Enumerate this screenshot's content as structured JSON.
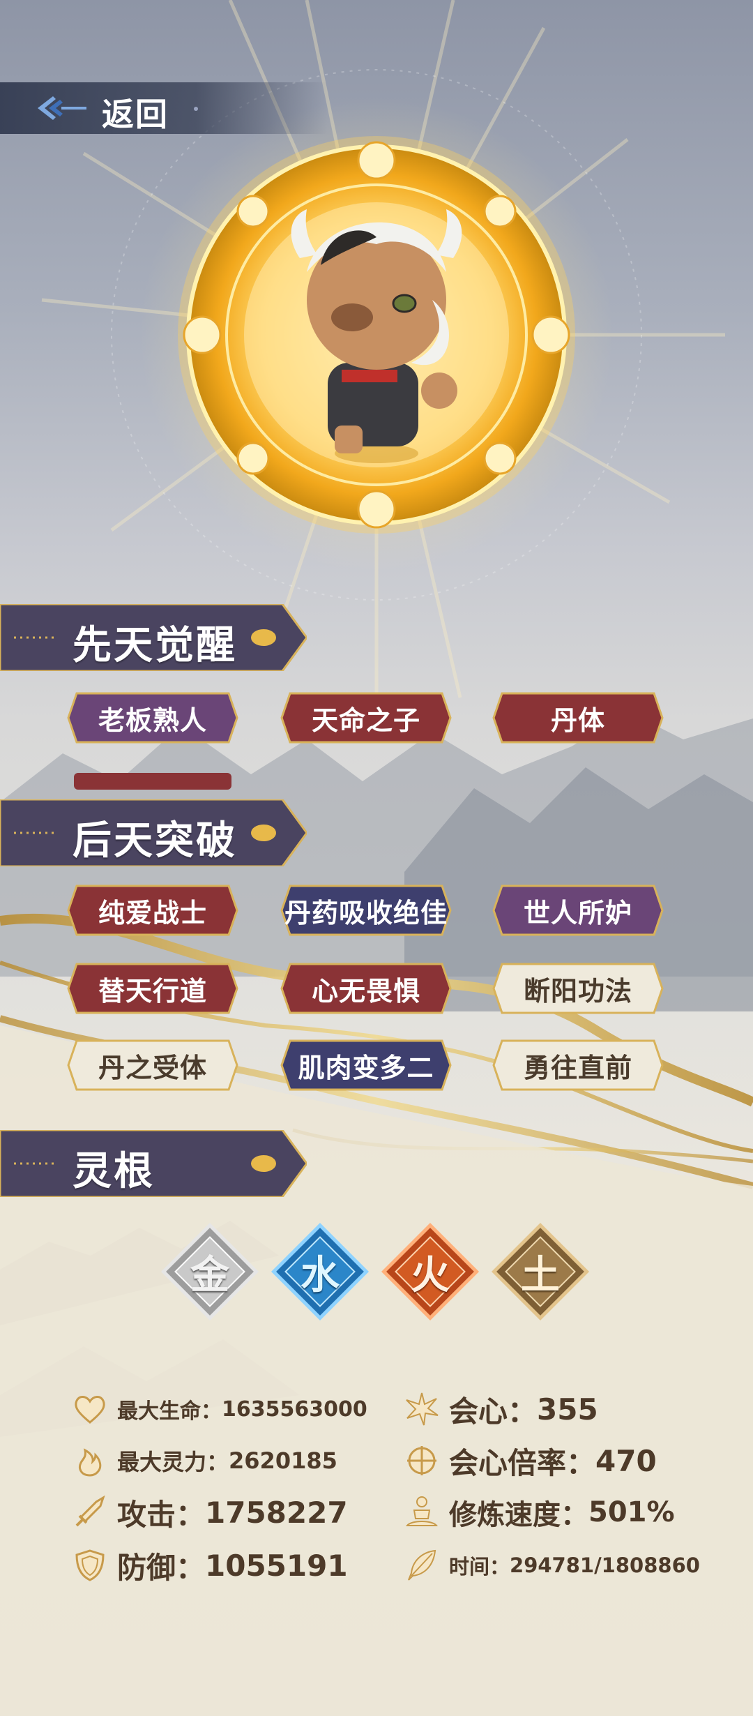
{
  "header": {
    "back_label": "返回"
  },
  "sections": {
    "innate": {
      "title": "先天觉醒"
    },
    "acquired": {
      "title": "后天突破"
    },
    "spirit_root": {
      "title": "灵根"
    }
  },
  "innate_tags": [
    {
      "label": "老板熟人",
      "style": "purple"
    },
    {
      "label": "天命之子",
      "style": "red"
    },
    {
      "label": "丹体",
      "style": "red"
    }
  ],
  "acquired_tags": [
    {
      "label": "纯爱战士",
      "style": "red"
    },
    {
      "label": "丹药吸收绝佳",
      "style": "indigo"
    },
    {
      "label": "世人所妒",
      "style": "purple"
    },
    {
      "label": "替天行道",
      "style": "red"
    },
    {
      "label": "心无畏惧",
      "style": "red"
    },
    {
      "label": "断阳功法",
      "style": "light"
    },
    {
      "label": "丹之受体",
      "style": "light"
    },
    {
      "label": "肌肉变多二",
      "style": "indigo"
    },
    {
      "label": "勇往直前",
      "style": "light"
    }
  ],
  "elements": [
    {
      "char": "金",
      "name": "metal",
      "color": "#b9b9b9"
    },
    {
      "char": "水",
      "name": "water",
      "color": "#2b86c9"
    },
    {
      "char": "火",
      "name": "fire",
      "color": "#d25a22"
    },
    {
      "char": "土",
      "name": "earth",
      "color": "#9c7a49"
    }
  ],
  "stats": {
    "max_hp": {
      "label": "最大生命：",
      "value": "1635563000",
      "icon": "heart-icon"
    },
    "max_spirit": {
      "label": "最大灵力：",
      "value": "2620185",
      "icon": "flame-icon"
    },
    "attack": {
      "label": "攻击：",
      "value": "1758227",
      "icon": "sword-icon"
    },
    "defense": {
      "label": "防御：",
      "value": "1055191",
      "icon": "shield-icon"
    },
    "crit": {
      "label": "会心：",
      "value": "355",
      "icon": "burst-icon"
    },
    "crit_multiplier": {
      "label": "会心倍率：",
      "value": "470",
      "icon": "crosshair-icon"
    },
    "cultivation_speed": {
      "label": "修炼速度：",
      "value": "501%",
      "icon": "meditation-icon"
    },
    "time": {
      "label": "时间：",
      "value": "294781/1808860",
      "icon": "feather-icon"
    }
  },
  "colors": {
    "tag_red": "#8a3336",
    "tag_purple": "#6a4577",
    "tag_indigo": "#3e3f6e",
    "tag_light": "#efeadc",
    "gold": "#d8b25a",
    "header_bg": "#4a4460"
  }
}
